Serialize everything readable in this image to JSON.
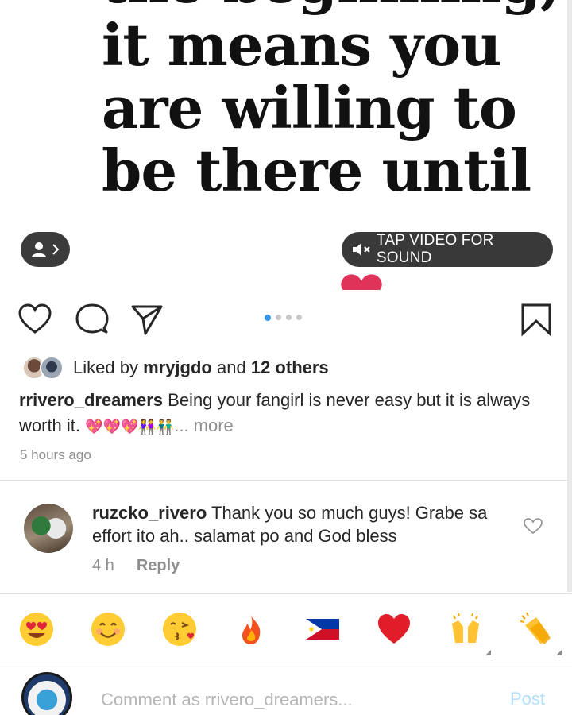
{
  "media": {
    "quote_lines": [
      "the beginning,",
      "it means you",
      "are willing to",
      "be there until",
      ""
    ],
    "sound_label": "TAP VIDEO FOR SOUND",
    "carousel_count": 4,
    "carousel_active": 1
  },
  "likes": {
    "prefix": "Liked by",
    "user": "mryjgdo",
    "joiner": "and",
    "others": "12 others"
  },
  "caption": {
    "user": "rrivero_dreamers",
    "text": "Being your fangirl is never easy but it is always worth it.",
    "emoji": "💖💖💖👭👬",
    "more": "... more"
  },
  "timestamp": "5 hours ago",
  "comment": {
    "user": "ruzcko_rivero",
    "text": "Thank you so much guys! Grabe sa effort ito ah.. salamat po and God bless",
    "age": "4 h",
    "reply_label": "Reply"
  },
  "reactions": [
    "heart-eyes-face",
    "smiling-face",
    "kissing-face",
    "fire",
    "philippines-flag",
    "red-heart",
    "raising-hands",
    "clapping-hands"
  ],
  "composer": {
    "placeholder": "Comment as rrivero_dreamers...",
    "post_label": "Post"
  },
  "colors": {
    "accent_blue": "#3897f0",
    "post_disabled": "#b2dffc",
    "muted_text": "#8e8e8e",
    "pill_bg": "#282828"
  }
}
